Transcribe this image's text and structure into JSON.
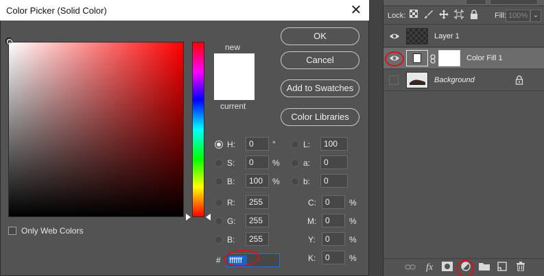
{
  "dialog": {
    "title": "Color Picker (Solid Color)",
    "close_icon": "close-icon",
    "preview": {
      "new_label": "new",
      "current_label": "current",
      "new_color": "#ffffff",
      "current_color": "#ffffff"
    },
    "buttons": {
      "ok": "OK",
      "cancel": "Cancel",
      "add_to_swatches": "Add to Swatches",
      "color_libraries": "Color Libraries"
    },
    "hsb": [
      {
        "label": "H:",
        "value": "0",
        "unit": "°",
        "selected": true
      },
      {
        "label": "S:",
        "value": "0",
        "unit": "%",
        "selected": false
      },
      {
        "label": "B:",
        "value": "100",
        "unit": "%",
        "selected": false
      }
    ],
    "rgb": [
      {
        "label": "R:",
        "value": "255"
      },
      {
        "label": "G:",
        "value": "255"
      },
      {
        "label": "B:",
        "value": "255"
      }
    ],
    "lab": [
      {
        "label": "L:",
        "value": "100"
      },
      {
        "label": "a:",
        "value": "0"
      },
      {
        "label": "b:",
        "value": "0"
      }
    ],
    "cmyk": [
      {
        "label": "C:",
        "value": "0",
        "unit": "%"
      },
      {
        "label": "M:",
        "value": "0",
        "unit": "%"
      },
      {
        "label": "Y:",
        "value": "0",
        "unit": "%"
      },
      {
        "label": "K:",
        "value": "0",
        "unit": "%"
      }
    ],
    "hex": {
      "label": "#",
      "value": "ffffff"
    },
    "only_web_colors": {
      "label": "Only Web Colors",
      "checked": false
    },
    "hue_color": "#ff0000"
  },
  "layers_panel": {
    "lock_label": "Lock:",
    "fill_label": "Fill:",
    "fill_value": "100%",
    "layers": [
      {
        "name": "Layer 1",
        "visible": true,
        "selected": false
      },
      {
        "name": "Color Fill 1",
        "visible": true,
        "selected": true
      },
      {
        "name": "Background",
        "visible": false,
        "selected": false,
        "locked": true
      }
    ],
    "bottom_icons": [
      "link-icon",
      "fx-icon",
      "mask-icon",
      "adjustment-layer-icon",
      "folder-icon",
      "new-layer-icon",
      "trash-icon"
    ],
    "annotation_color": "#d2141e"
  }
}
